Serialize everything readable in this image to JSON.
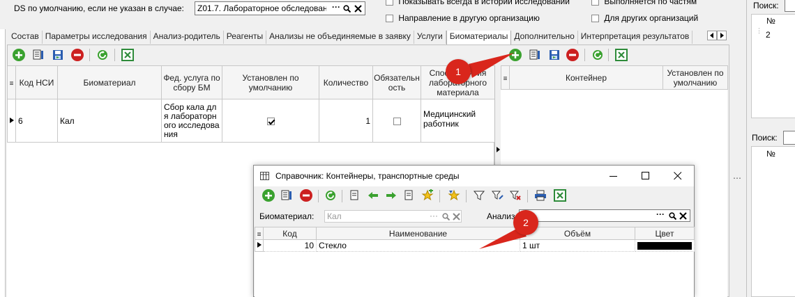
{
  "top": {
    "ds_label": "DS по умолчанию, если не указан в случае:",
    "ds_value": "Z01.7. Лабораторное обследован",
    "field_dots": "···",
    "cb_history": "Показывать всегда в истории исследований",
    "cb_direction": "Направление в другую организацию",
    "cb_parts": "Выполняется по частям",
    "cb_other_org": "Для других организаций"
  },
  "tabs": [
    "Состав",
    "Параметры исследования",
    "Анализ-родитель",
    "Реагенты",
    "Анализы не объединяемые в заявку",
    "Услуги",
    "Биоматериалы",
    "Дополнительно",
    "Интерпретация результатов"
  ],
  "left_grid": {
    "headers": [
      "Код НСИ",
      "Биоматериал",
      "Фед. услуга по сбору БМ",
      "Установлен по умолчанию",
      "Количество",
      "Обязательность",
      "Способ взятия лабораторного материала"
    ],
    "row": {
      "code": "6",
      "name": "Кал",
      "service": "Сбор кала для лабораторного исследования",
      "default_checked": true,
      "qty": "1",
      "required_checked": false,
      "method": "Медицинский работник"
    }
  },
  "right_grid": {
    "headers": [
      "Контейнер",
      "Установлен по умолчанию"
    ]
  },
  "far_right": {
    "search_label": "Поиск:",
    "col_no": "№",
    "row_value": "2",
    "search_label2": "Поиск:",
    "col_no2": "№"
  },
  "dialog": {
    "title": "Справочник: Контейнеры, транспортные среды",
    "bio_label": "Биоматериал:",
    "bio_placeholder": "Кал",
    "analysis_label": "Анализ",
    "headers": [
      "Код",
      "Наименование",
      "Объём",
      "Цвет"
    ],
    "row": {
      "code": "10",
      "name": "Стекло",
      "volume": "1 шт",
      "color": "#000000"
    }
  },
  "callouts": [
    "1",
    "2"
  ],
  "colors": {
    "callout": "#d9261c",
    "add": "#3aa12f",
    "delete": "#cc2020",
    "tab_active": "#ffffff"
  }
}
